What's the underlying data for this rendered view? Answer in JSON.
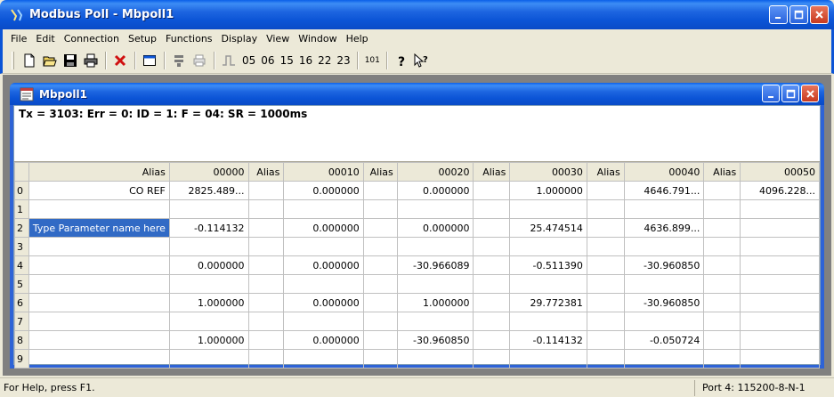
{
  "app": {
    "title": "Modbus Poll - Mbpoll1"
  },
  "menu": {
    "items": [
      "File",
      "Edit",
      "Connection",
      "Setup",
      "Functions",
      "Display",
      "View",
      "Window",
      "Help"
    ]
  },
  "toolbar": {
    "function_codes": [
      "05",
      "06",
      "15",
      "16",
      "22",
      "23"
    ],
    "counter_label": "101"
  },
  "child": {
    "title": "Mbpoll1",
    "status": "Tx = 3103: Err = 0: ID = 1: F = 04: SR = 1000ms"
  },
  "grid": {
    "headers": [
      "Alias",
      "00000",
      "Alias",
      "00010",
      "Alias",
      "00020",
      "Alias",
      "00030",
      "Alias",
      "00040",
      "Alias",
      "00050"
    ],
    "rows": [
      {
        "n": "0",
        "cells": [
          "CO REF",
          "2825.489...",
          "",
          "0.000000",
          "",
          "0.000000",
          "",
          "1.000000",
          "",
          "4646.791...",
          "",
          "4096.228..."
        ]
      },
      {
        "n": "1",
        "cells": [
          "",
          "",
          "",
          "",
          "",
          "",
          "",
          "",
          "",
          "",
          "",
          ""
        ]
      },
      {
        "n": "2",
        "cells": [
          "Type Parameter name here",
          "-0.114132",
          "",
          "0.000000",
          "",
          "0.000000",
          "",
          "25.474514",
          "",
          "4636.899...",
          "",
          ""
        ]
      },
      {
        "n": "3",
        "cells": [
          "",
          "",
          "",
          "",
          "",
          "",
          "",
          "",
          "",
          "",
          "",
          ""
        ]
      },
      {
        "n": "4",
        "cells": [
          "",
          "0.000000",
          "",
          "0.000000",
          "",
          "-30.966089",
          "",
          "-0.511390",
          "",
          "-30.960850",
          "",
          ""
        ]
      },
      {
        "n": "5",
        "cells": [
          "",
          "",
          "",
          "",
          "",
          "",
          "",
          "",
          "",
          "",
          "",
          ""
        ]
      },
      {
        "n": "6",
        "cells": [
          "",
          "1.000000",
          "",
          "0.000000",
          "",
          "1.000000",
          "",
          "29.772381",
          "",
          "-30.960850",
          "",
          ""
        ]
      },
      {
        "n": "7",
        "cells": [
          "",
          "",
          "",
          "",
          "",
          "",
          "",
          "",
          "",
          "",
          "",
          ""
        ]
      },
      {
        "n": "8",
        "cells": [
          "",
          "1.000000",
          "",
          "0.000000",
          "",
          "-30.960850",
          "",
          "-0.114132",
          "",
          "-0.050724",
          "",
          ""
        ]
      },
      {
        "n": "9",
        "cells": [
          "",
          "",
          "",
          "",
          "",
          "",
          "",
          "",
          "",
          "",
          "",
          ""
        ]
      }
    ]
  },
  "statusbar": {
    "help": "For Help, press F1.",
    "port": "Port 4: 115200-8-N-1"
  },
  "colors": {
    "titlebar": "#0b54d6",
    "selection": "#316ac5",
    "face": "#ece9d8"
  }
}
